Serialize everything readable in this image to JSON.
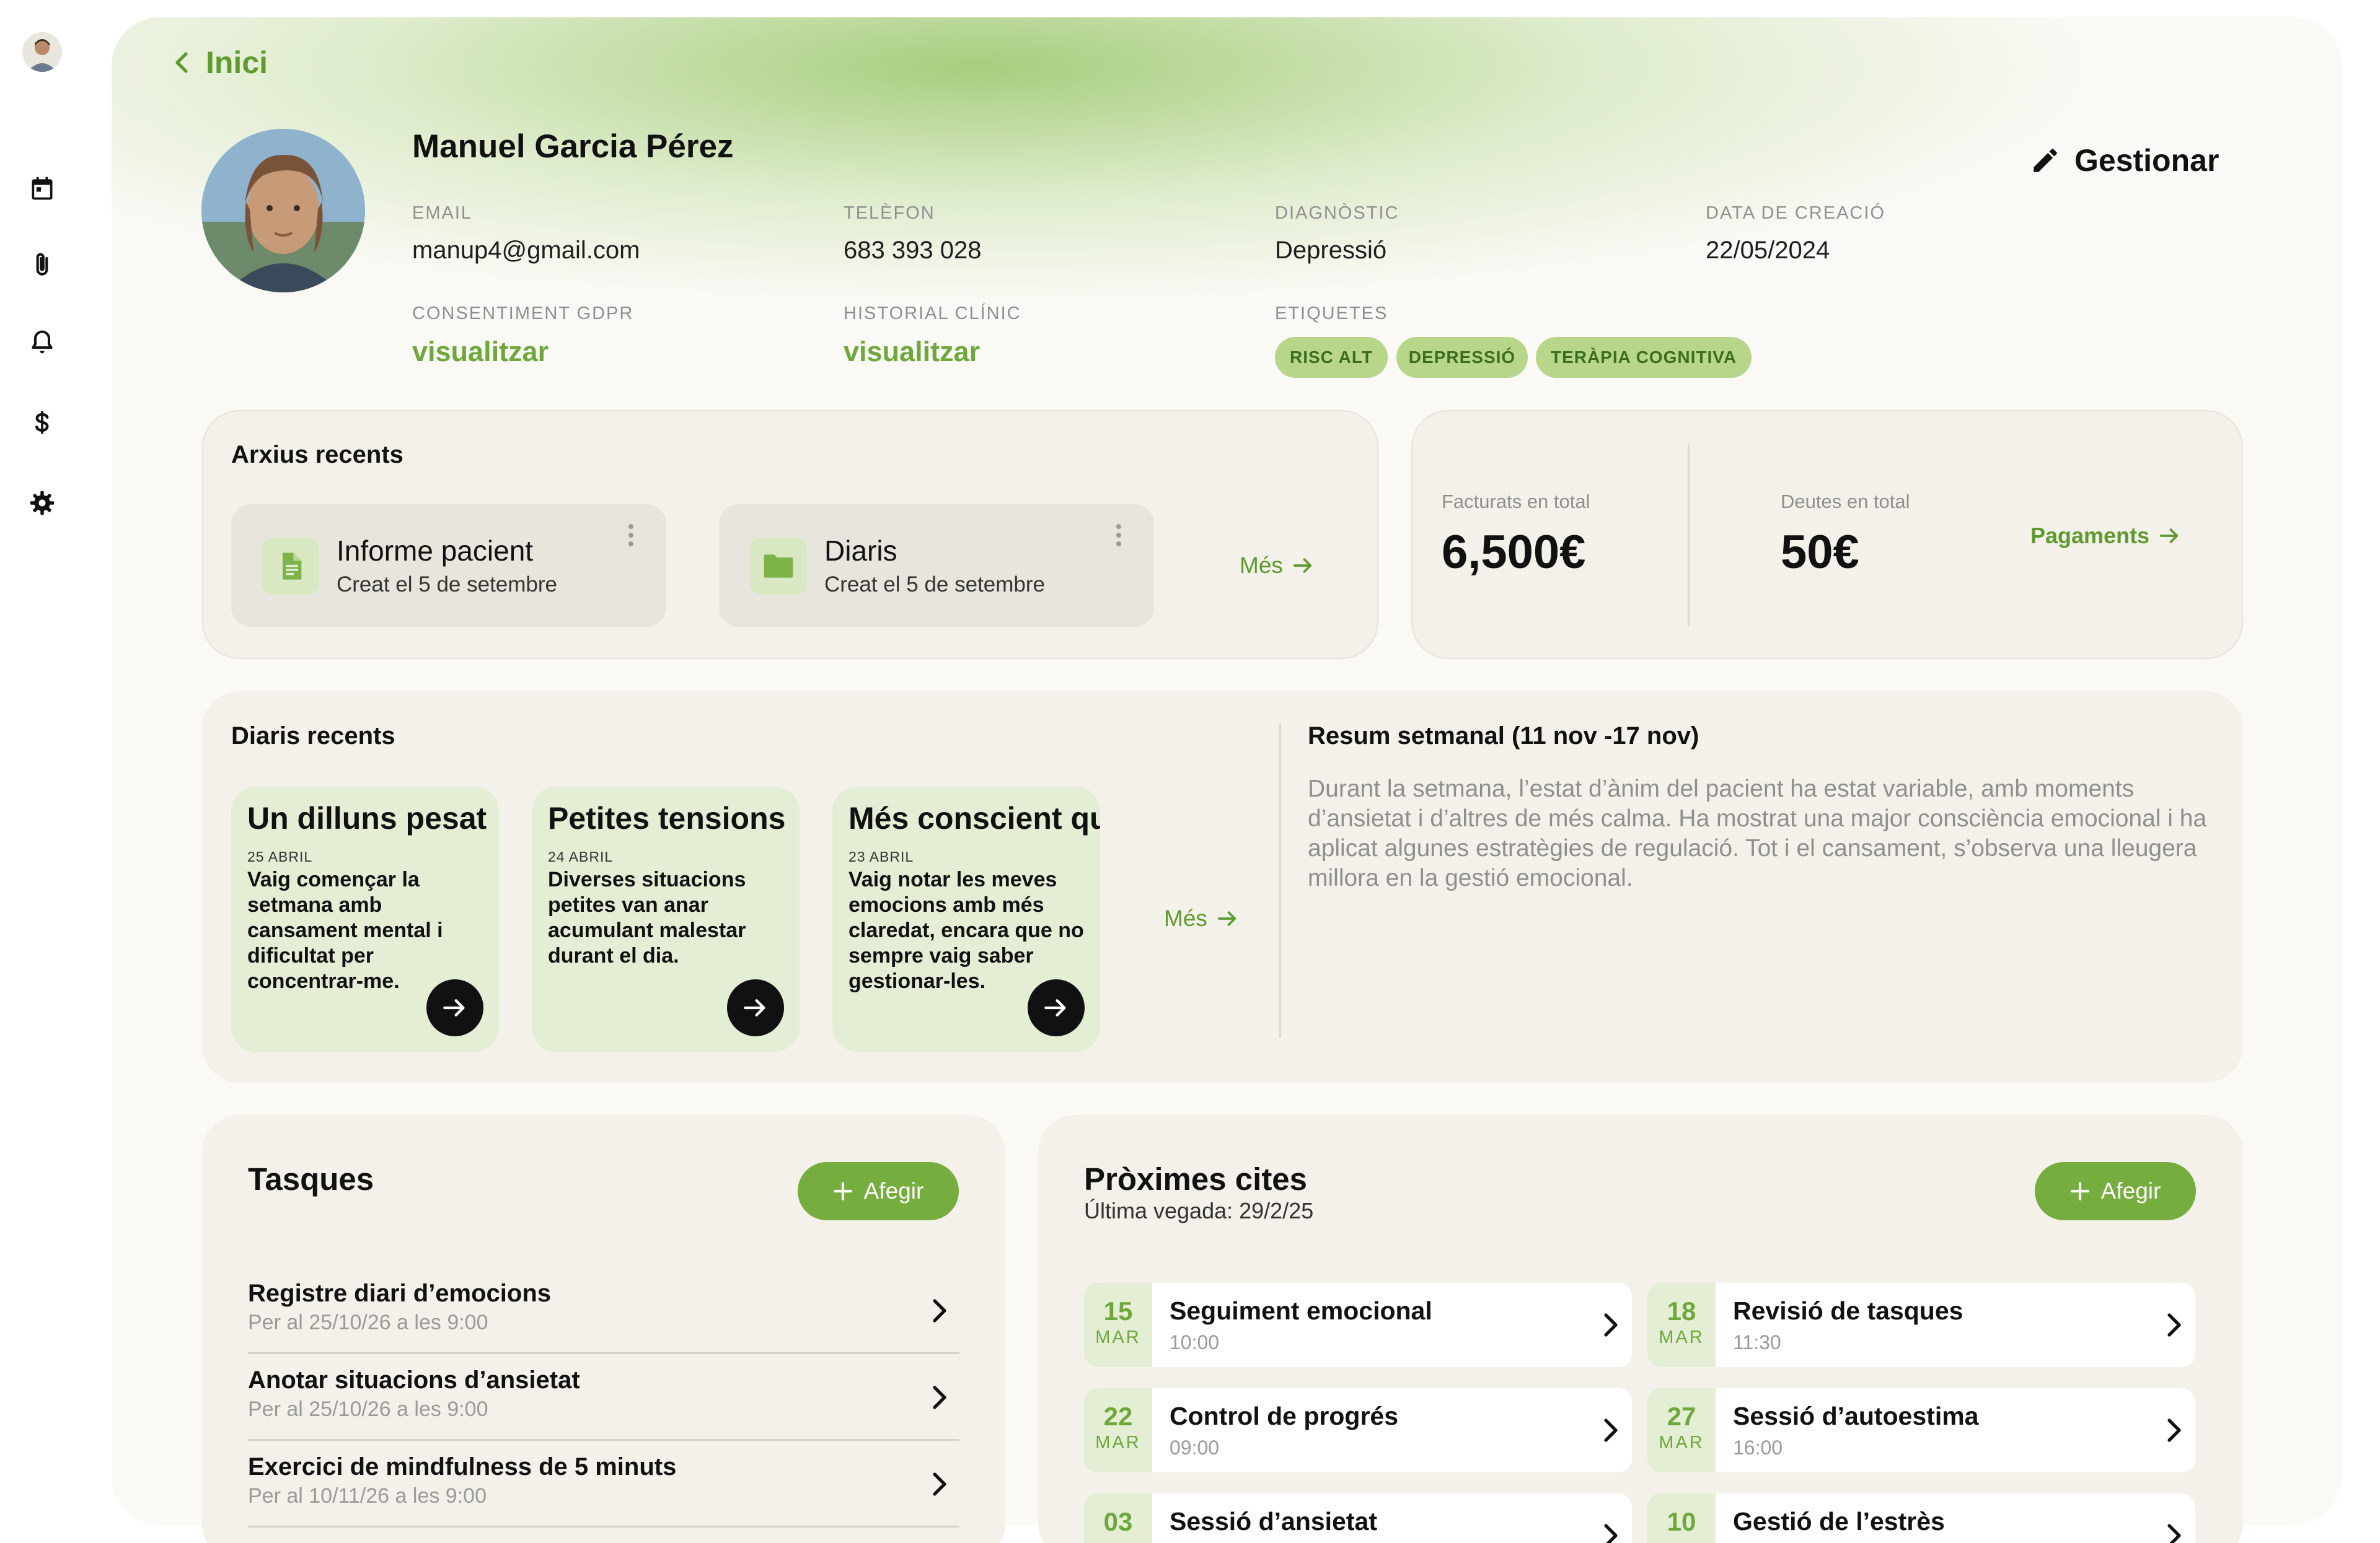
{
  "nav": {
    "back_label": "Inici",
    "icons": [
      "avatar",
      "calendar-icon",
      "paperclip-icon",
      "bell-icon",
      "dollar-icon",
      "gear-icon"
    ]
  },
  "patient": {
    "name": "Manuel Garcia Pérez",
    "manage_label": "Gestionar",
    "fields": {
      "email_label": "EMAIL",
      "email": "manup4@gmail.com",
      "phone_label": "TELÈFON",
      "phone": "683 393 028",
      "diagnosis_label": "DIAGNÒSTIC",
      "diagnosis": "Depressió",
      "created_label": "DATA DE CREACIÓ",
      "created": "22/05/2024",
      "gdpr_label": "CONSENTIMENT GDPR",
      "gdpr_link": "visualitzar",
      "history_label": "HISTORIAL CLÍNIC",
      "history_link": "visualitzar",
      "tags_label": "ETIQUETES"
    },
    "tags": [
      "RISC ALT",
      "DEPRESSIÓ",
      "TERÀPIA COGNITIVA"
    ]
  },
  "colors": {
    "accent": "#76ad3f",
    "accent_text": "#6ea83a",
    "tag_bg": "#b7d68a",
    "panel_bg": "#f3f1ea",
    "card_green": "#e4eed5"
  },
  "files": {
    "title": "Arxius recents",
    "items": [
      {
        "name": "Informe pacient",
        "subtitle": "Creat el 5 de setembre",
        "icon": "document-icon"
      },
      {
        "name": "Diaris",
        "subtitle": "Creat el 5 de setembre",
        "icon": "folder-icon"
      }
    ],
    "more_label": "Més"
  },
  "billing": {
    "invoiced_label": "Facturats en total",
    "invoiced_value": "6,500€",
    "debts_label": "Deutes en total",
    "debts_value": "50€",
    "payments_label": "Pagaments"
  },
  "diaries": {
    "title": "Diaris recents",
    "items": [
      {
        "title": "Un dilluns pesat",
        "date": "25 ABRIL",
        "text": "Vaig començar la setmana amb cansament mental i dificultat per concentrar-me."
      },
      {
        "title": "Petites tensions",
        "date": "24 ABRIL",
        "text": "Diverses situacions petites van anar acumulant malestar durant el dia."
      },
      {
        "title": "Més conscient qu",
        "date": "23 ABRIL",
        "text": "Vaig notar les meves emocions amb més claredat, encara que no sempre vaig saber gestionar-les."
      }
    ],
    "more_label": "Més"
  },
  "summary": {
    "title": "Resum setmanal (11 nov -17 nov)",
    "text": "Durant la setmana, l’estat d’ànim del pacient ha estat variable, amb moments d’ansietat i d’altres de més calma. Ha mostrat una major consciència emocional i ha aplicat algunes estratègies de regulació. Tot i el cansament, s’observa una lleugera millora en la gestió emocional."
  },
  "tasks": {
    "title": "Tasques",
    "add_label": "Afegir",
    "items": [
      {
        "title": "Registre diari d’emocions",
        "due": "Per al 25/10/26 a les 9:00"
      },
      {
        "title": "Anotar situacions d’ansietat",
        "due": "Per al 25/10/26 a les 9:00"
      },
      {
        "title": "Exercici de mindfulness de 5 minuts",
        "due": "Per al 10/11/26 a les 9:00"
      }
    ]
  },
  "appointments": {
    "title": "Pròximes cites",
    "subtitle": "Última vegada: 29/2/25",
    "add_label": "Afegir",
    "items": [
      {
        "day": "15",
        "month": "MAR",
        "title": "Seguiment emocional",
        "time": "10:00"
      },
      {
        "day": "18",
        "month": "MAR",
        "title": "Revisió de tasques",
        "time": "11:30"
      },
      {
        "day": "22",
        "month": "MAR",
        "title": "Control de progrés",
        "time": "09:00"
      },
      {
        "day": "27",
        "month": "MAR",
        "title": "Sessió d’autoestima",
        "time": "16:00"
      },
      {
        "day": "03",
        "month": "",
        "title": "Sessió d’ansietat",
        "time": ""
      },
      {
        "day": "10",
        "month": "",
        "title": "Gestió de l’estrès",
        "time": ""
      }
    ]
  }
}
